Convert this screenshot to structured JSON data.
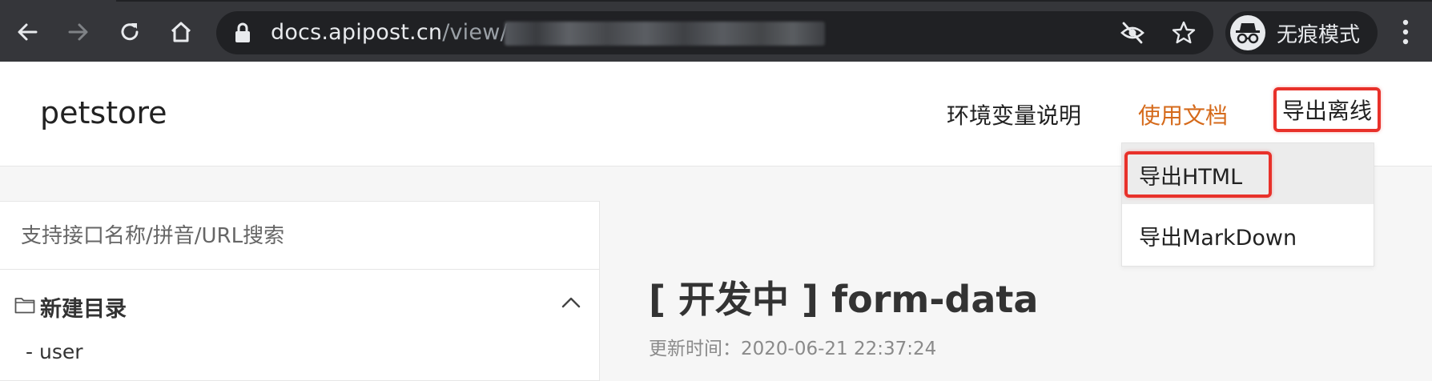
{
  "browser": {
    "url_host": "docs.apipost.cn",
    "url_path_visible": "/view/",
    "incognito_label": "无痕模式",
    "icons": [
      "back-icon",
      "forward-icon",
      "reload-icon",
      "home-icon",
      "lock-icon",
      "eye-slash-icon",
      "star-icon",
      "incognito-icon",
      "kebab-menu-icon"
    ],
    "colors": {
      "chrome": "#35363a",
      "omnibox": "#202124",
      "text": "#e8eaed",
      "muted": "#9aa0a6"
    }
  },
  "header": {
    "brand": "petstore",
    "nav": {
      "env": "环境变量说明",
      "docs": "使用文档",
      "export": "导出离线"
    },
    "colors": {
      "active_link": "#d56a1b",
      "highlight_box": "#e8312a"
    }
  },
  "dropdown": {
    "items": [
      {
        "label": "导出HTML"
      },
      {
        "label": "导出MarkDown"
      }
    ]
  },
  "sidebar": {
    "search_placeholder": "支持接口名称/拼音/URL搜索",
    "folder": {
      "label": "新建目录",
      "icon": "folder-icon",
      "expanded": true
    },
    "items": [
      {
        "label": "- user"
      }
    ]
  },
  "main": {
    "title": "[ 开发中 ] form-data",
    "updated": "更新时间：2020-06-21 22:37:24"
  }
}
